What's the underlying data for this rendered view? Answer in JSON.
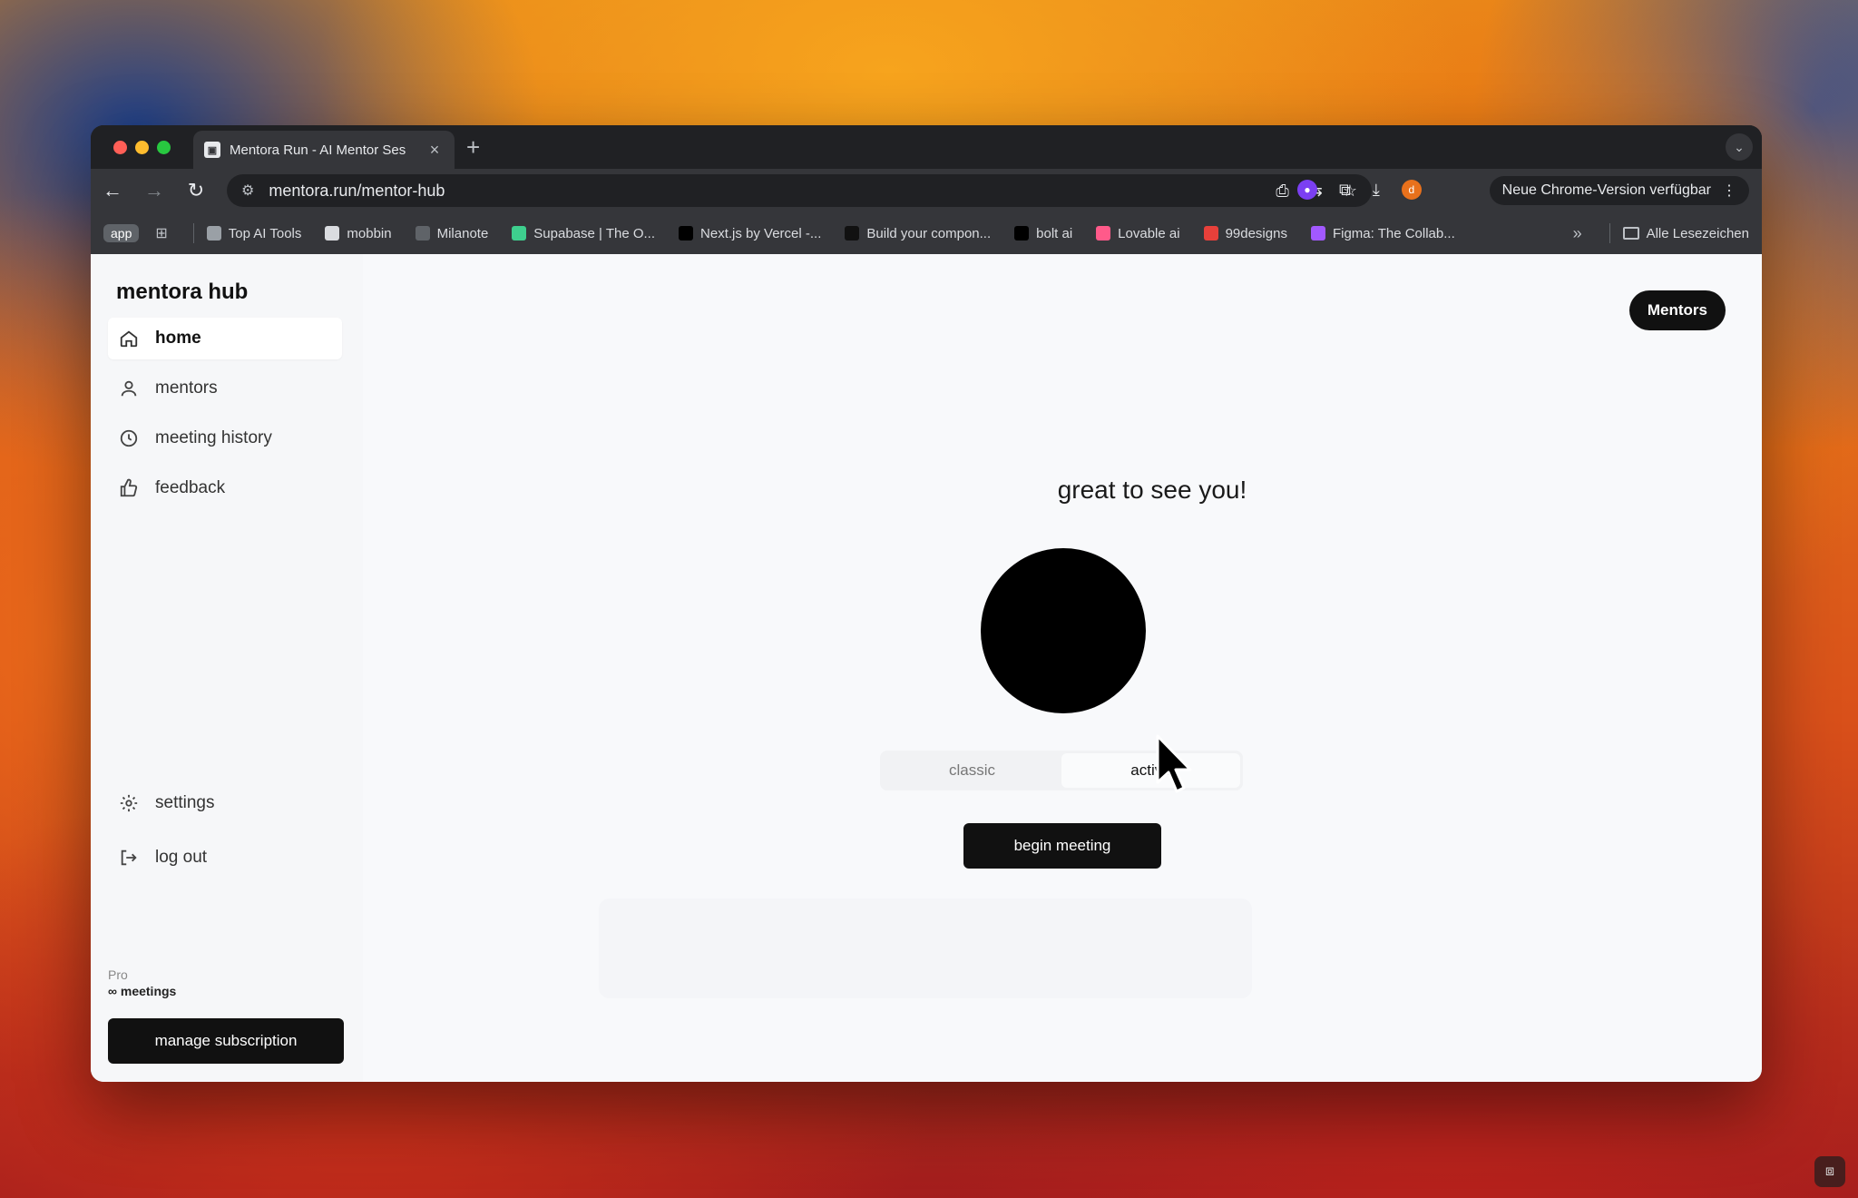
{
  "browser": {
    "tab_title": "Mentora Run - AI Mentor Ses",
    "tab_close": "×",
    "new_tab": "+",
    "url": "mentora.run/mentor-hub",
    "update_label": "Neue Chrome-Version verfügbar",
    "profile_initial": "d"
  },
  "bookmarks": {
    "app_label": "app",
    "items": [
      {
        "label": "Top AI Tools",
        "color": "#9aa0a6"
      },
      {
        "label": "mobbin",
        "color": "#dadce0"
      },
      {
        "label": "Milanote",
        "color": "#5f6368"
      },
      {
        "label": "Supabase | The O...",
        "color": "#3ecf8e"
      },
      {
        "label": "Next.js by Vercel -...",
        "color": "#000000"
      },
      {
        "label": "Build your compon...",
        "color": "#111111"
      },
      {
        "label": "bolt ai",
        "color": "#000000"
      },
      {
        "label": "Lovable ai",
        "color": "#ff5a8a"
      },
      {
        "label": "99designs",
        "color": "#e8403a"
      },
      {
        "label": "Figma: The Collab...",
        "color": "#a259ff"
      }
    ],
    "more": "»",
    "all_bookmarks": "Alle Lesezeichen"
  },
  "sidebar": {
    "brand": "mentora hub",
    "items": [
      {
        "label": "home",
        "icon": "home-icon",
        "active": true
      },
      {
        "label": "mentors",
        "icon": "user-icon",
        "active": false
      },
      {
        "label": "meeting history",
        "icon": "clock-icon",
        "active": false
      },
      {
        "label": "feedback",
        "icon": "thumbs-up-icon",
        "active": false
      }
    ],
    "bottom_items": [
      {
        "label": "settings",
        "icon": "gear-icon"
      },
      {
        "label": "log out",
        "icon": "logout-icon"
      }
    ],
    "plan_name": "Pro",
    "plan_meetings": "∞ meetings",
    "manage_label": "manage subscription"
  },
  "main": {
    "mentors_button": "Mentors",
    "greeting": "great to see you!",
    "modes": [
      {
        "label": "classic",
        "selected": false
      },
      {
        "label": "active",
        "selected": true
      }
    ],
    "begin_label": "begin meeting"
  }
}
